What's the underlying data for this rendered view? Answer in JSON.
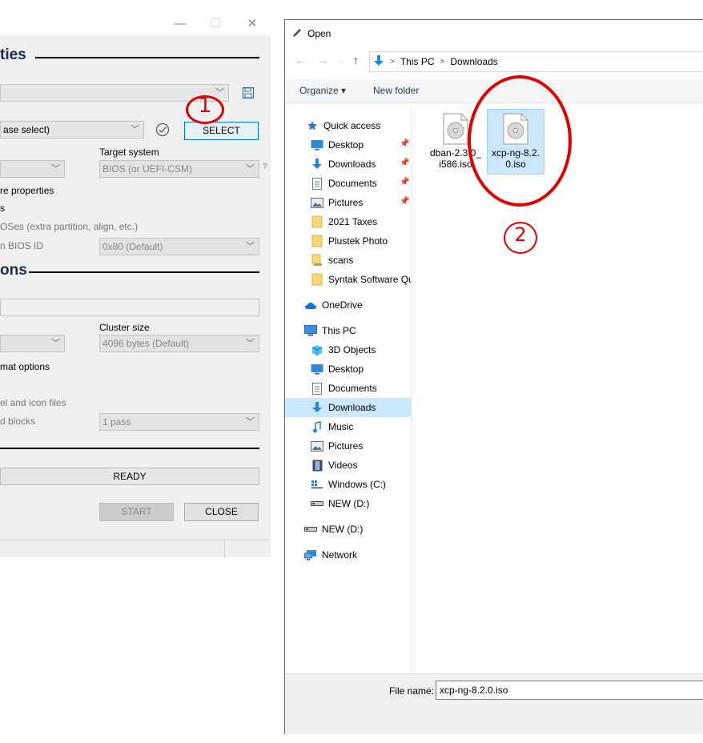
{
  "rufus": {
    "window_controls": {
      "minimize": "—",
      "maximize": "☐",
      "close": "✕"
    },
    "drive_props_heading": "ties",
    "device_value": "",
    "boot_selection_value": "ase select)",
    "select_button": "SELECT",
    "target_system_label": "Target system",
    "partition_scheme_value": "",
    "target_system_value": "BIOS (or UEFI-CSM)",
    "target_help": "?",
    "hide_props_label": "re properties",
    "list_drives_label": "s",
    "fixes_label": "OSes (extra partition, align, etc.)",
    "bios_id_label": "n BIOS ID",
    "bios_id_value": "0x80 (Default)",
    "format_heading": "ons",
    "volume_label_value": "",
    "cluster_size_label": "Cluster size",
    "filesystem_value": "",
    "cluster_size_value": "4096 bytes (Default)",
    "advanced_format_label": "mat options",
    "ext_label_label": "el and icon files",
    "bad_blocks_label": "d blocks",
    "passes_value": "1 pass",
    "status_text": "READY",
    "start_button": "START",
    "close_button": "CLOSE"
  },
  "annotations": {
    "step1": "1",
    "step2": "2",
    "accent": "#e00000"
  },
  "dialog": {
    "title": "Open",
    "breadcrumb": [
      "This PC",
      "Downloads"
    ],
    "organize": "Organize ▾",
    "new_folder": "New folder",
    "nav": {
      "quick_access": "Quick access",
      "qa_desktop": "Desktop",
      "qa_downloads": "Downloads",
      "qa_documents": "Documents",
      "qa_pictures": "Pictures",
      "taxes": "2021 Taxes",
      "plustek": "Plustek Photo",
      "scans": "scans",
      "syntak": "Syntak Software Qu",
      "onedrive": "OneDrive",
      "this_pc": "This PC",
      "objects3d": "3D Objects",
      "pc_desktop": "Desktop",
      "pc_documents": "Documents",
      "pc_downloads": "Downloads",
      "music": "Music",
      "pc_pictures": "Pictures",
      "videos": "Videos",
      "windows_c": "Windows (C:)",
      "new_d": "NEW (D:)",
      "new_d2": "NEW (D:)",
      "network": "Network"
    },
    "files": [
      {
        "line1": "dban-2.3.0_",
        "line2": "i586.iso"
      },
      {
        "line1": "xcp-ng-8.2.",
        "line2": "0.iso"
      }
    ],
    "file_name_label": "File name:",
    "file_name_value": "xcp-ng-8.2.0.iso",
    "selection_color": "#cce8ff"
  }
}
